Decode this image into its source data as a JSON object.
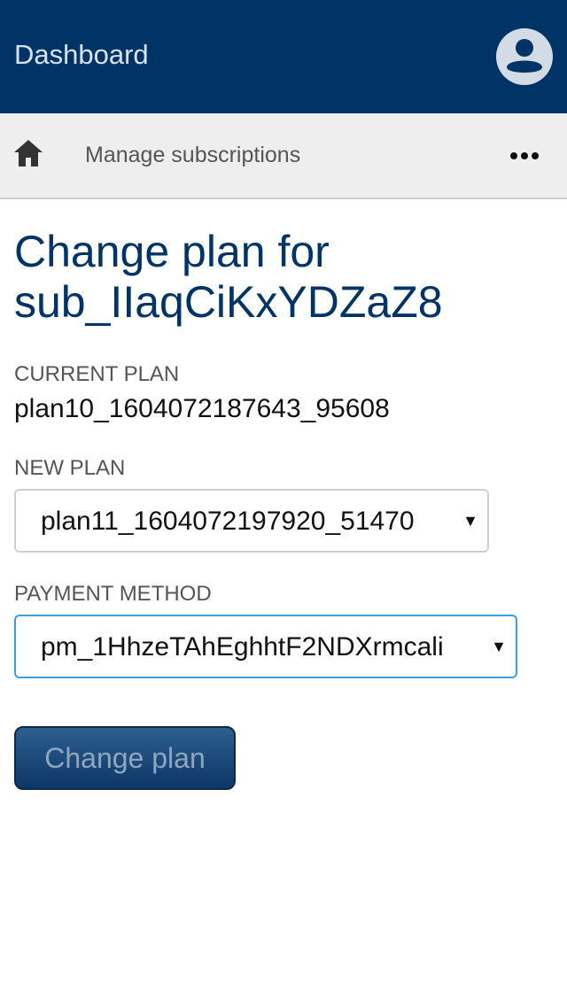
{
  "header": {
    "title": "Dashboard",
    "avatar_icon": "user-avatar-icon",
    "background_color": "#003366"
  },
  "navbar": {
    "home_icon": "home-icon",
    "label": "Manage subscriptions",
    "more_icon": "more-horizontal-icon"
  },
  "main": {
    "title": "Change plan for sub_IIaqCiKxYDZaZ8",
    "current_plan": {
      "label": "CURRENT PLAN",
      "value": "plan10_1604072187643_95608"
    },
    "new_plan": {
      "label": "NEW PLAN",
      "selected": "plan11_1604072197920_51470"
    },
    "payment_method": {
      "label": "PAYMENT METHOD",
      "selected": "pm_1HhzeTAhEghhtF2NDXrmcali"
    },
    "submit_label": "Change plan",
    "accent_color": "#003366",
    "focus_color": "#3aa0e0"
  }
}
